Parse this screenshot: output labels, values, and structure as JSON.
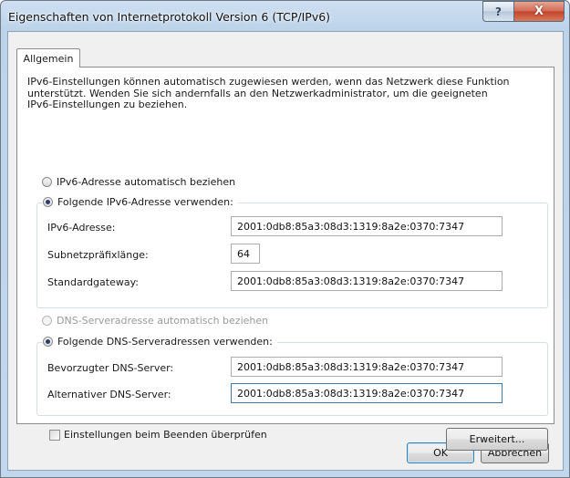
{
  "window": {
    "title": "Eigenschaften von Internetprotokoll Version 6 (TCP/IPv6)",
    "help_label": "?",
    "close_label": "X"
  },
  "tabs": [
    {
      "label": "Allgemein",
      "selected": true
    }
  ],
  "general": {
    "intro_text": "IPv6-Einstellungen können automatisch zugewiesen werden, wenn das Netzwerk diese Funktion unterstützt. Wenden Sie sich andernfalls an den Netzwerkadministrator, um die geeigneten IPv6-Einstellungen zu beziehen.",
    "address": {
      "auto_label": "IPv6-Adresse automatisch beziehen",
      "auto_selected": false,
      "manual_label": "Folgende IPv6-Adresse verwenden:",
      "manual_selected": true,
      "ipv6_label": "IPv6-Adresse:",
      "ipv6_value": "2001:0db8:85a3:08d3:1319:8a2e:0370:7347",
      "prefix_label": "Subnetzpräfixlänge:",
      "prefix_value": "64",
      "gateway_label": "Standardgateway:",
      "gateway_value": "2001:0db8:85a3:08d3:1319:8a2e:0370:7347"
    },
    "dns": {
      "auto_label": "DNS-Serveradresse automatisch beziehen",
      "auto_selected": false,
      "auto_disabled": true,
      "manual_label": "Folgende DNS-Serveradressen verwenden:",
      "manual_selected": true,
      "preferred_label": "Bevorzugter DNS-Server:",
      "preferred_value": "2001:0db8:85a3:08d3:1319:8a2e:0370:7347",
      "alternate_label": "Alternativer DNS-Server:",
      "alternate_value": "2001:0db8:85a3:08d3:1319:8a2e:0370:7347"
    },
    "validate_label": "Einstellungen beim Beenden überprüfen",
    "validate_checked": false,
    "advanced_label": "Erweitert..."
  },
  "footer": {
    "ok_label": "OK",
    "cancel_label": "Abbrechen"
  }
}
